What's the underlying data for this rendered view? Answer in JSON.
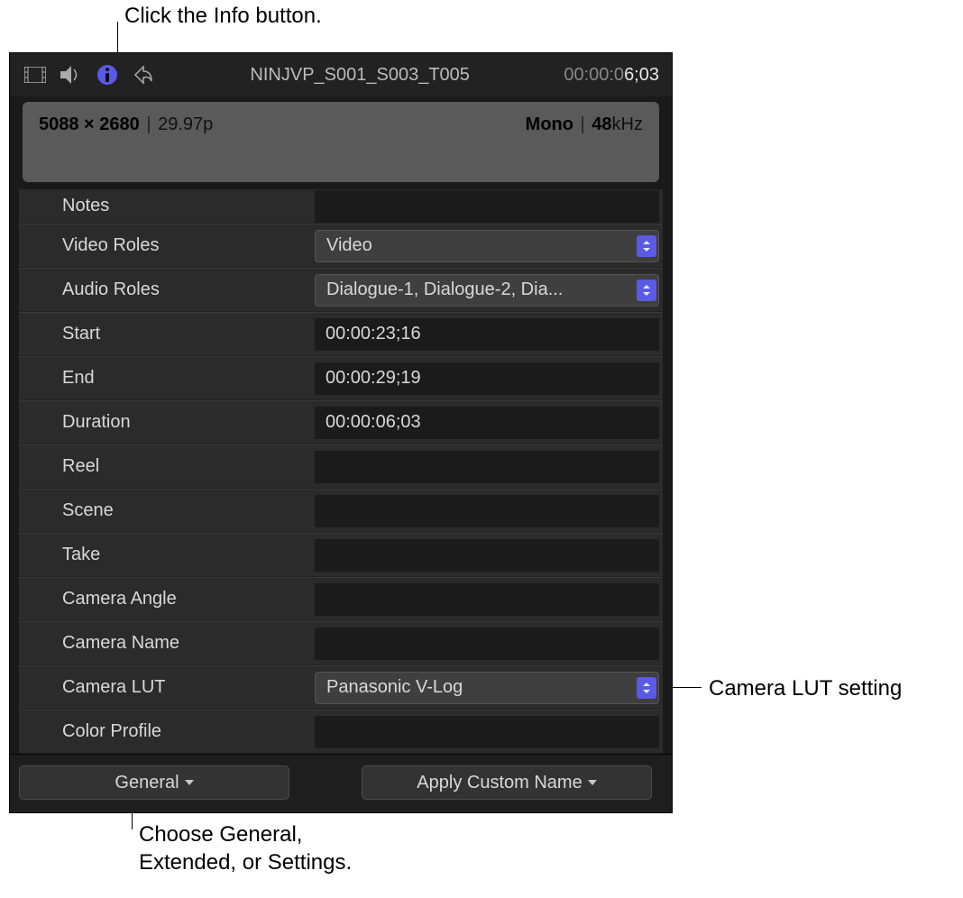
{
  "callouts": {
    "info": "Click the Info button.",
    "lut": "Camera LUT setting",
    "views": "Choose General, Extended, or Settings."
  },
  "toolbar": {
    "clip_name": "NINJVP_S001_S003_T005",
    "timecode_prefix": "00:00:0",
    "timecode_end": "6;03"
  },
  "summary": {
    "res_w": "5088",
    "res_h": "2680",
    "fps": "29.97p",
    "audio": "Mono",
    "khz_label": "48",
    "khz_unit": "kHz"
  },
  "fields": {
    "notes": {
      "label": "Notes",
      "value": ""
    },
    "video_roles": {
      "label": "Video Roles",
      "value": "Video"
    },
    "audio_roles": {
      "label": "Audio Roles",
      "value": "Dialogue-1, Dialogue-2, Dia..."
    },
    "start": {
      "label": "Start",
      "value": "00:00:23;16"
    },
    "end": {
      "label": "End",
      "value": "00:00:29;19"
    },
    "duration": {
      "label": "Duration",
      "value": "00:00:06;03"
    },
    "reel": {
      "label": "Reel",
      "value": ""
    },
    "scene": {
      "label": "Scene",
      "value": ""
    },
    "take": {
      "label": "Take",
      "value": ""
    },
    "camera_angle": {
      "label": "Camera Angle",
      "value": ""
    },
    "camera_name": {
      "label": "Camera Name",
      "value": ""
    },
    "camera_lut": {
      "label": "Camera LUT",
      "value": "Panasonic V-Log"
    },
    "color_profile": {
      "label": "Color Profile",
      "value": ""
    }
  },
  "buttons": {
    "views": "General",
    "apply_name": "Apply Custom Name"
  }
}
